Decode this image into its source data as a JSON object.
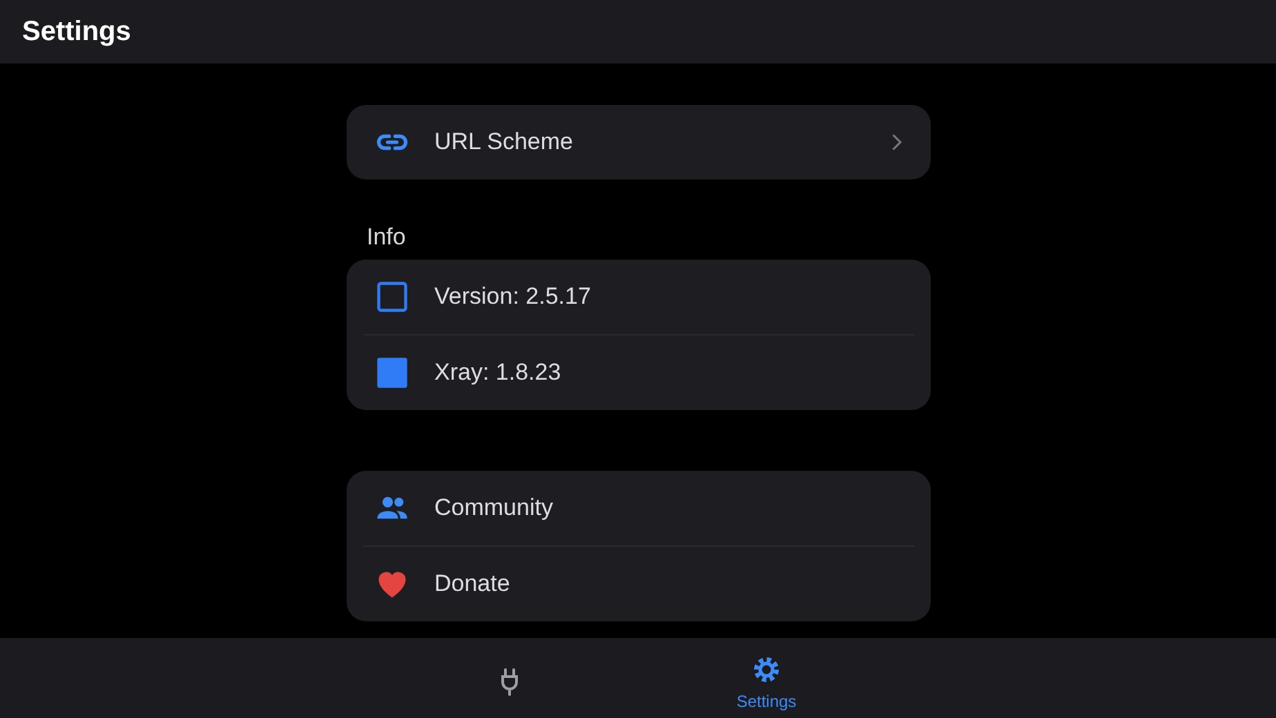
{
  "app_bar": {
    "title": "Settings"
  },
  "sections": [
    {
      "rows": [
        {
          "label": "URL Scheme",
          "chevron": true
        }
      ]
    },
    {
      "header": "Info",
      "rows": [
        {
          "label": "Version: 2.5.17",
          "chevron": false
        },
        {
          "label": "Xray: 1.8.23",
          "chevron": false
        }
      ]
    },
    {
      "rows": [
        {
          "label": "Community",
          "chevron": false
        },
        {
          "label": "Donate",
          "chevron": false
        }
      ]
    }
  ],
  "nav_bar": {
    "tabs": [
      {
        "selected": false
      },
      {
        "label": "Settings",
        "selected": true
      }
    ]
  }
}
